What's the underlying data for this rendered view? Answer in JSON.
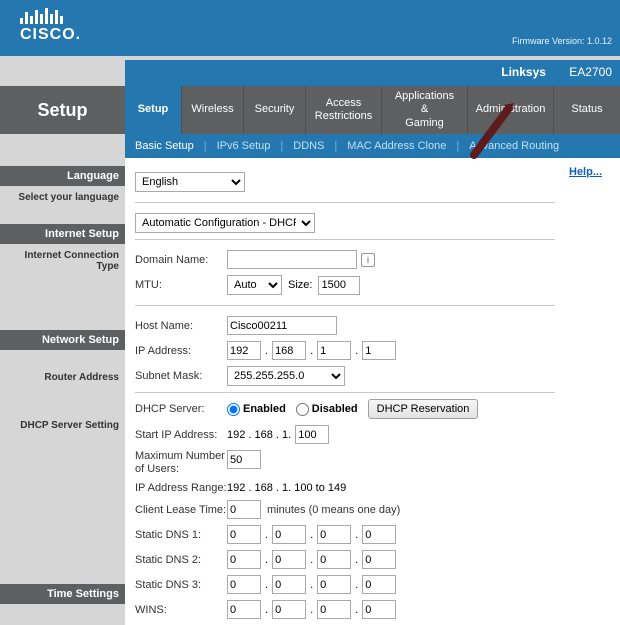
{
  "firmware": "Firmware Version: 1.0.12",
  "brand": "CISCO.",
  "model_brand": "Linksys",
  "model_num": "EA2700",
  "page_title": "Setup",
  "tabs": {
    "t0": "Setup",
    "t1": "Wireless",
    "t2": "Security",
    "t3": "Access\nRestrictions",
    "t4": "Applications &\nGaming",
    "t5": "Administration",
    "t6": "Status"
  },
  "subtabs": {
    "s0": "Basic Setup",
    "s1": "IPv6 Setup",
    "s2": "DDNS",
    "s3": "MAC Address Clone",
    "s4": "Advanced Routing"
  },
  "side": {
    "language_h": "Language",
    "language_s": "Select your language",
    "internet_h": "Internet Setup",
    "internet_s": "Internet Connection Type",
    "network_h": "Network Setup",
    "router_s": "Router Address",
    "dhcp_s": "DHCP Server Setting",
    "time_s": "Time Settings"
  },
  "help": "Help...",
  "lang_value": "English",
  "conn_type": "Automatic Configuration - DHCP",
  "domain_lbl": "Domain Name:",
  "domain_val": "",
  "mtu_lbl": "MTU:",
  "mtu_mode": "Auto",
  "size_lbl": "Size:",
  "size_val": "1500",
  "host_lbl": "Host Name:",
  "host_val": "Cisco00211",
  "ip_lbl": "IP Address:",
  "ip": [
    "192",
    "168",
    "1",
    "1"
  ],
  "mask_lbl": "Subnet Mask:",
  "mask_val": "255.255.255.0",
  "dhcp_lbl": "DHCP Server:",
  "enabled": "Enabled",
  "disabled": "Disabled",
  "dhcp_res": "DHCP Reservation",
  "startip_lbl": "Start IP  Address:",
  "startip_prefix": "192 . 168 . 1.",
  "startip_val": "100",
  "maxusers_lbl": "Maximum Number of Users:",
  "maxusers_val": "50",
  "range_lbl": "IP Address Range:",
  "range_val": "192 . 168 . 1. 100 to 149",
  "lease_lbl": "Client Lease Time:",
  "lease_val": "0",
  "lease_note": "minutes (0 means one day)",
  "dns1_lbl": "Static DNS 1:",
  "dns2_lbl": "Static DNS 2:",
  "dns3_lbl": "Static DNS 3:",
  "wins_lbl": "WINS:",
  "zero": [
    "0",
    "0",
    "0",
    "0"
  ]
}
